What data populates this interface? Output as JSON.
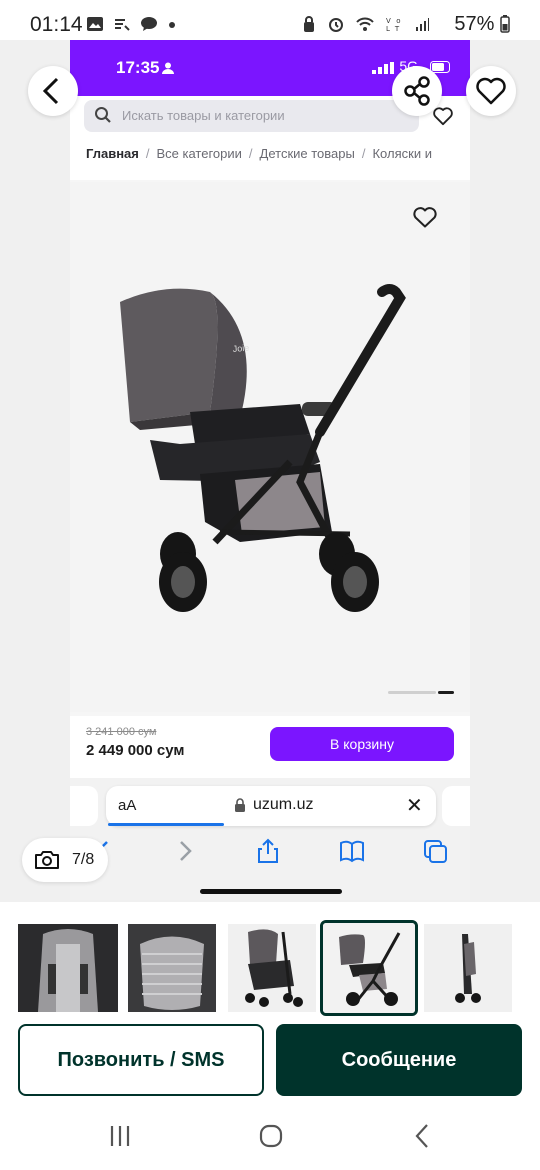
{
  "status_bar": {
    "time": "01:14",
    "left_icons": [
      "image-icon",
      "wifi-calling-icon",
      "chat-icon",
      "dot-icon"
    ],
    "right_icons": [
      "lock-icon",
      "alarm-icon",
      "wifi-icon",
      "volte-icon",
      "signal-icon"
    ],
    "battery": "57%"
  },
  "inner_screen": {
    "status": {
      "time": "17:35",
      "network": "5G"
    },
    "search": {
      "placeholder": "Искать товары и категории"
    },
    "breadcrumbs": [
      "Главная",
      "Все категории",
      "Детские товары",
      "Коляски и"
    ],
    "brand_label": "Joie",
    "price": {
      "old": "3 241 000 сум",
      "current": "2 449 000 сум"
    },
    "cart_button": "В корзину",
    "browser": {
      "text_size": "аА",
      "url": "uzum.uz"
    },
    "accent_color": "#7b15ff"
  },
  "viewer": {
    "counter": "7/8",
    "icons": [
      "back-arrow-icon",
      "share-icon",
      "heart-icon",
      "camera-icon"
    ]
  },
  "thumbnails": [
    {
      "name": "seat-insert",
      "selected": false
    },
    {
      "name": "seat-back",
      "selected": false
    },
    {
      "name": "stroller-front",
      "selected": false
    },
    {
      "name": "stroller-side",
      "selected": true
    },
    {
      "name": "stroller-folded",
      "selected": false
    }
  ],
  "actions": {
    "call": "Позвонить / SMS",
    "message": "Сообщение",
    "primary_color": "#00332b"
  },
  "system_nav": [
    "recent-apps-icon",
    "home-icon",
    "back-icon"
  ]
}
